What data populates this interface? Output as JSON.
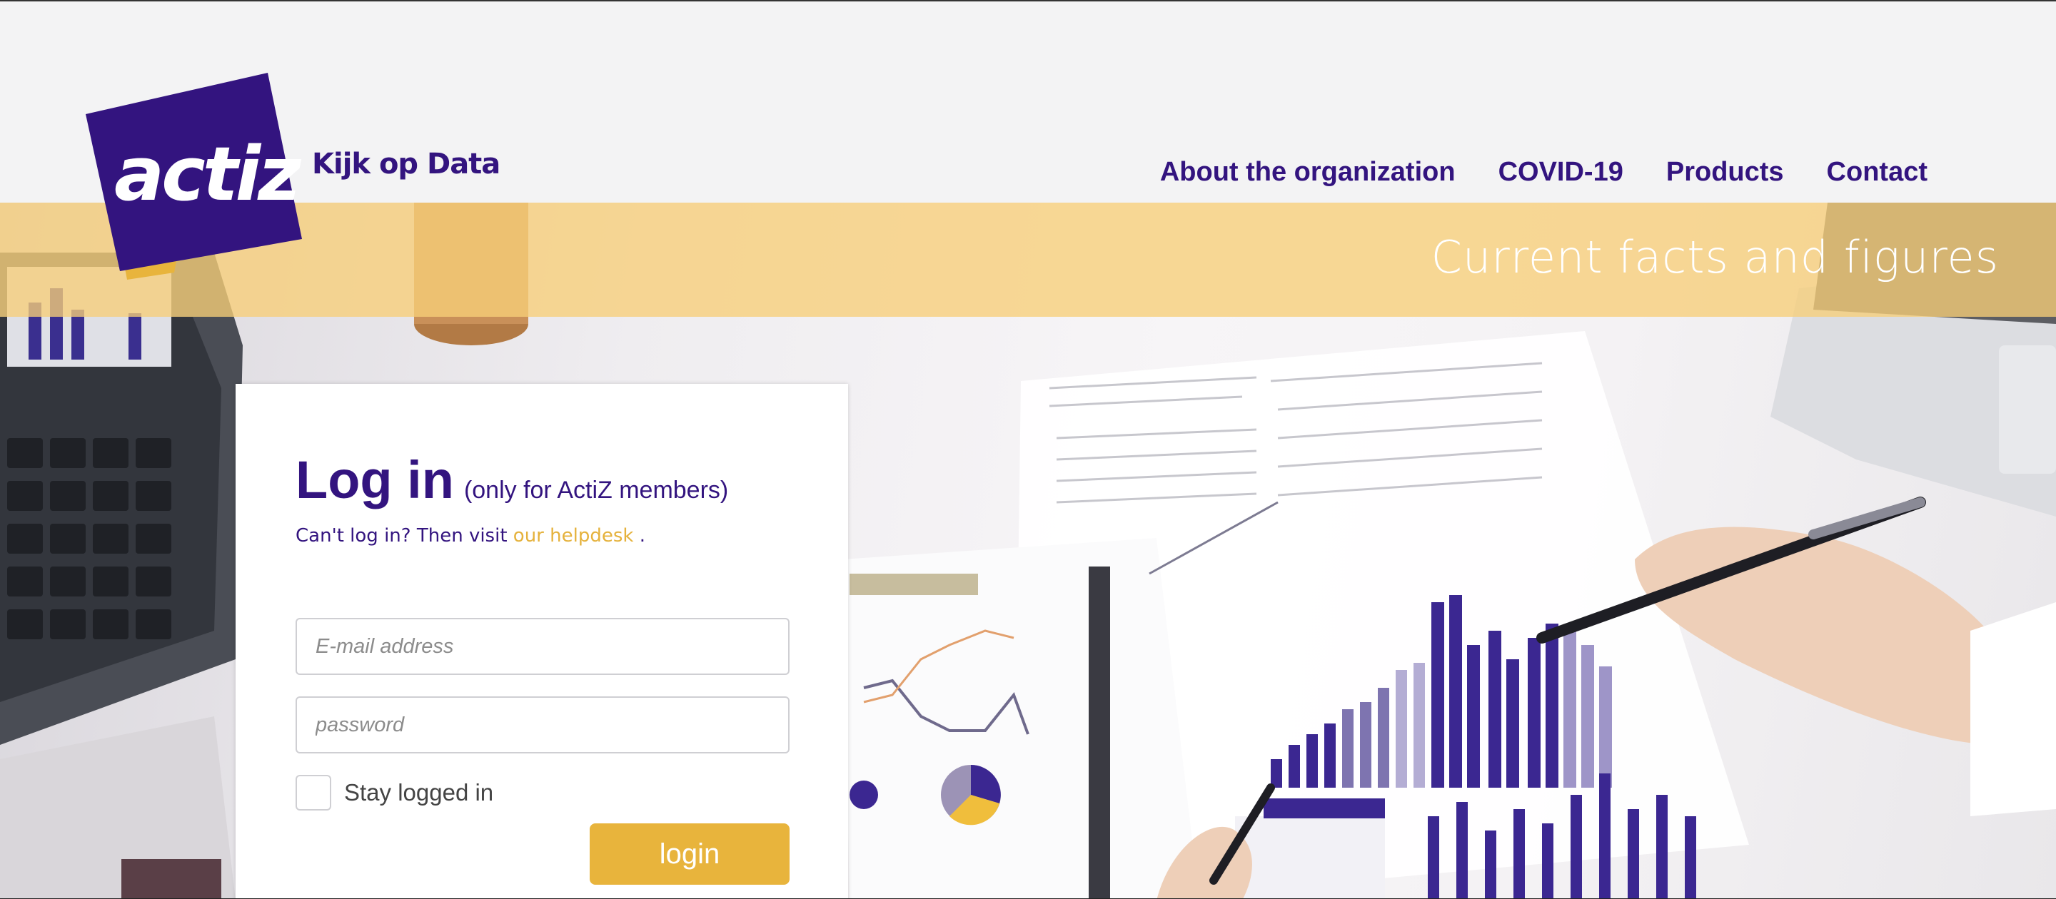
{
  "brand": {
    "logo_text": "actiz",
    "tagline": "Kijk op Data",
    "colors": {
      "purple": "#33147f",
      "gold": "#e8b43c",
      "banner": "#f7ce78"
    }
  },
  "nav": {
    "items": [
      {
        "label": "About the organization"
      },
      {
        "label": "COVID-19"
      },
      {
        "label": "Products"
      },
      {
        "label": "Contact"
      }
    ]
  },
  "banner": {
    "text": "Current facts and figures"
  },
  "login": {
    "title": "Log in",
    "subtitle": "(only for ActiZ members)",
    "help_prefix": "Can't log in? Then visit",
    "help_link": "our helpdesk",
    "help_suffix": ".",
    "email": {
      "value": "",
      "placeholder": "E-mail address"
    },
    "password": {
      "value": "",
      "placeholder": "password"
    },
    "remember_label": "Stay logged in",
    "remember_checked": false,
    "submit_label": "login"
  }
}
